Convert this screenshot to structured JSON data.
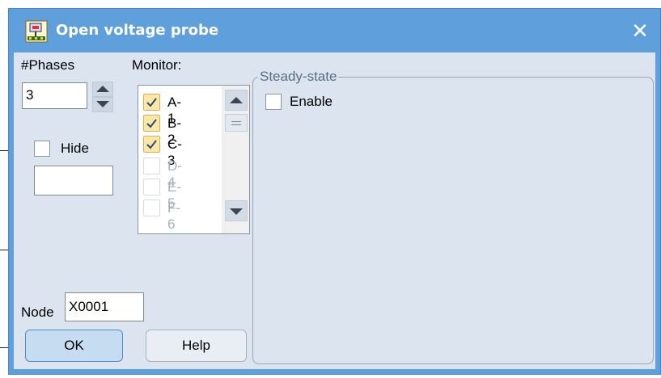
{
  "window": {
    "title": "Open voltage probe",
    "close_glyph": "✕"
  },
  "phases": {
    "label": "#Phases",
    "value": "3"
  },
  "monitor": {
    "label": "Monitor:",
    "items": [
      {
        "label": "A-1",
        "checked": true,
        "enabled": true
      },
      {
        "label": "B-2",
        "checked": true,
        "enabled": true
      },
      {
        "label": "C-3",
        "checked": true,
        "enabled": true
      },
      {
        "label": "D-4",
        "checked": false,
        "enabled": false
      },
      {
        "label": "E-5",
        "checked": false,
        "enabled": false
      },
      {
        "label": "F-6",
        "checked": false,
        "enabled": false
      }
    ]
  },
  "hide": {
    "label": "Hide",
    "checked": false,
    "value": ""
  },
  "node": {
    "label": "Node",
    "value": "X0001"
  },
  "steady_state": {
    "legend": "Steady-state",
    "enable_label": "Enable",
    "enable_checked": false
  },
  "buttons": {
    "ok_label": "OK",
    "help_label": "Help"
  },
  "colors": {
    "titlebar": "#5e9fdc",
    "client": "#dce5ef",
    "checked_fill": "#fbe8a6",
    "ok_button": "#c6dcf1"
  }
}
